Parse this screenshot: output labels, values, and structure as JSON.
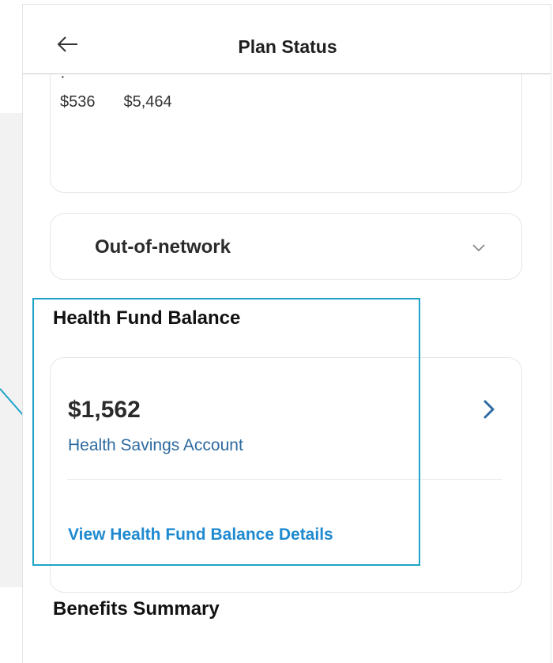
{
  "header": {
    "title": "Plan Status",
    "back_icon": "arrow-left-icon"
  },
  "spending": {
    "amounts": [
      "$536",
      "$5,464"
    ]
  },
  "out_of_network": {
    "label": "Out-of-network",
    "icon": "chevron-down-icon"
  },
  "health_fund": {
    "section_title": "Health Fund Balance",
    "amount": "$1,562",
    "account_type": "Health Savings Account",
    "details_link": "View Health Fund Balance Details",
    "icon": "chevron-right-icon"
  },
  "benefits": {
    "section_title": "Benefits Summary"
  },
  "colors": {
    "highlight": "#1fa3c9",
    "link": "#1f8ad0",
    "account_type": "#2d6aa0"
  }
}
